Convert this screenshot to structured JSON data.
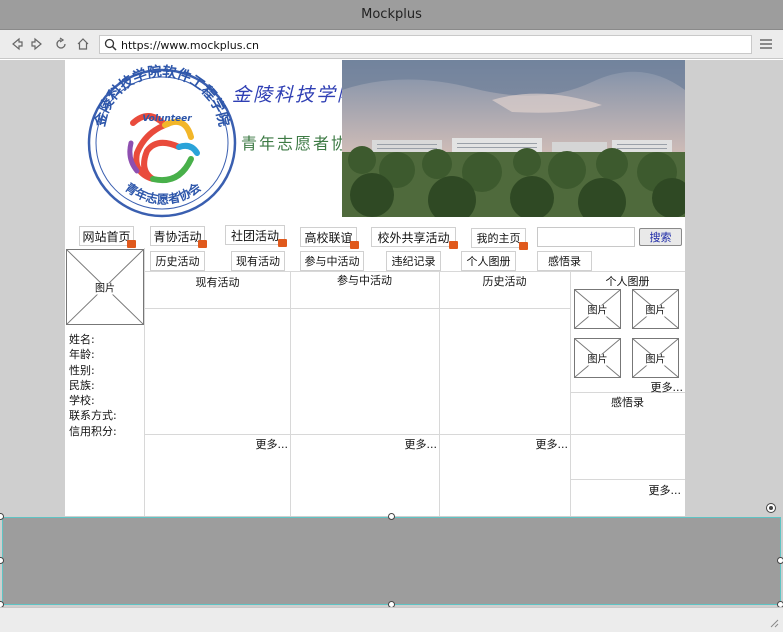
{
  "window": {
    "title": "Mockplus"
  },
  "browser": {
    "url": "https://www.mockplus.cn"
  },
  "header": {
    "site_title": "金陵科技学院",
    "org_title": "青年志愿者协会"
  },
  "logo": {
    "outer_text": "金陵科技学院软件工程学院",
    "bottom_text": "青年志愿者协会",
    "center_text": "Volunteer"
  },
  "nav_primary": [
    "网站首页",
    "青协活动",
    "社团活动",
    "高校联谊",
    "校外共享活动",
    "我的主页"
  ],
  "search": {
    "placeholder": "",
    "button": "搜索"
  },
  "nav_secondary": [
    "历史活动",
    "现有活动",
    "参与中活动",
    "违纪记录",
    "个人图册",
    "感悟录"
  ],
  "profile": {
    "photo_label": "图片",
    "fields": [
      "姓名:",
      "年龄:",
      "性别:",
      "民族:",
      "学校:",
      "联系方式:",
      "信用积分:"
    ]
  },
  "panels": {
    "current": {
      "title": "现有活动",
      "more": "更多..."
    },
    "ongoing": {
      "title": "参与中活动",
      "more": "更多..."
    },
    "history": {
      "title": "历史活动",
      "more": "更多..."
    },
    "album": {
      "title": "个人图册",
      "image_label": "图片",
      "more": "更多..."
    },
    "journal": {
      "title": "感悟录",
      "more": "更多..."
    }
  },
  "colors": {
    "accent_blue": "#2f3fb4",
    "org_green": "#3d7a44",
    "flag_orange": "#e0591c",
    "selection_border": "#5fc4c4"
  }
}
